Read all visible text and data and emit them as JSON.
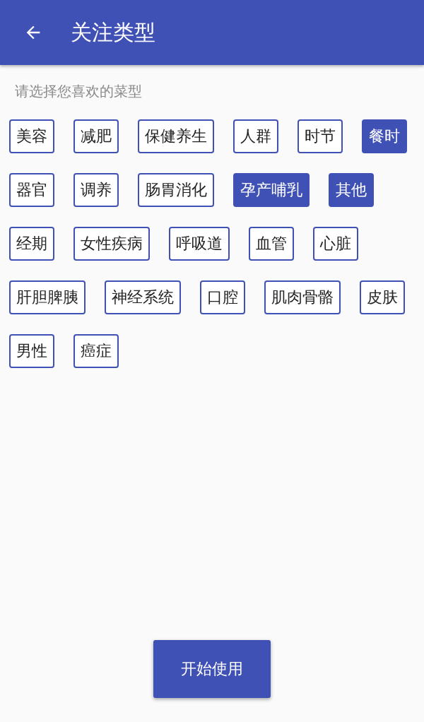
{
  "app_bar": {
    "title": "关注类型"
  },
  "prompt": "请选择您喜欢的菜型",
  "tags": [
    {
      "label": "美容",
      "selected": false
    },
    {
      "label": "减肥",
      "selected": false
    },
    {
      "label": "保健养生",
      "selected": false
    },
    {
      "label": "人群",
      "selected": false
    },
    {
      "label": "时节",
      "selected": false
    },
    {
      "label": "餐时",
      "selected": true
    },
    {
      "label": "器官",
      "selected": false
    },
    {
      "label": "调养",
      "selected": false
    },
    {
      "label": "肠胃消化",
      "selected": false
    },
    {
      "label": "孕产哺乳",
      "selected": true
    },
    {
      "label": "其他",
      "selected": true
    },
    {
      "label": "经期",
      "selected": false
    },
    {
      "label": "女性疾病",
      "selected": false
    },
    {
      "label": "呼吸道",
      "selected": false
    },
    {
      "label": "血管",
      "selected": false
    },
    {
      "label": "心脏",
      "selected": false
    },
    {
      "label": "肝胆脾胰",
      "selected": false
    },
    {
      "label": "神经系统",
      "selected": false
    },
    {
      "label": "口腔",
      "selected": false
    },
    {
      "label": "肌肉骨骼",
      "selected": false
    },
    {
      "label": "皮肤",
      "selected": false
    },
    {
      "label": "男性",
      "selected": false
    },
    {
      "label": "癌症",
      "selected": false
    }
  ],
  "start_button": "开始使用"
}
